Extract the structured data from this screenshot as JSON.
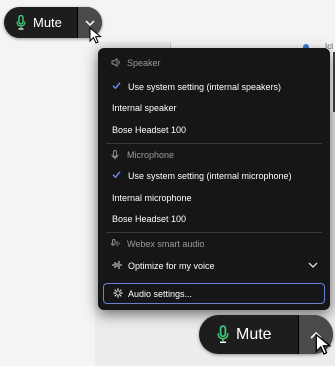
{
  "top_button": {
    "label": "Mute"
  },
  "bottom_button": {
    "label": "Mute"
  },
  "background": {
    "window_text": "Icl"
  },
  "menu": {
    "speaker_header": "Speaker",
    "speaker_options": [
      {
        "label": "Use system setting (internal speakers)",
        "selected": true
      },
      {
        "label": "Internal speaker",
        "selected": false
      },
      {
        "label": "Bose Headset 100",
        "selected": false
      }
    ],
    "microphone_header": "Microphone",
    "microphone_options": [
      {
        "label": "Use system setting (internal microphone)",
        "selected": true
      },
      {
        "label": "Internal microphone",
        "selected": false
      },
      {
        "label": "Bose Headset 100",
        "selected": false
      }
    ],
    "smart_audio_header": "Webex smart audio",
    "smart_audio_value": "Optimize for my voice",
    "settings_label": "Audio settings..."
  },
  "colors": {
    "mic_green": "#3fcf7a",
    "accent_check": "#6c8ef0",
    "focus_border": "#6a7fd6"
  },
  "icons": [
    "microphone-icon",
    "chevron-down-icon",
    "chevron-up-icon",
    "speaker-icon",
    "checkmark-icon",
    "smart-audio-icon",
    "voice-icon",
    "gear-icon",
    "mouse-cursor-icon"
  ]
}
